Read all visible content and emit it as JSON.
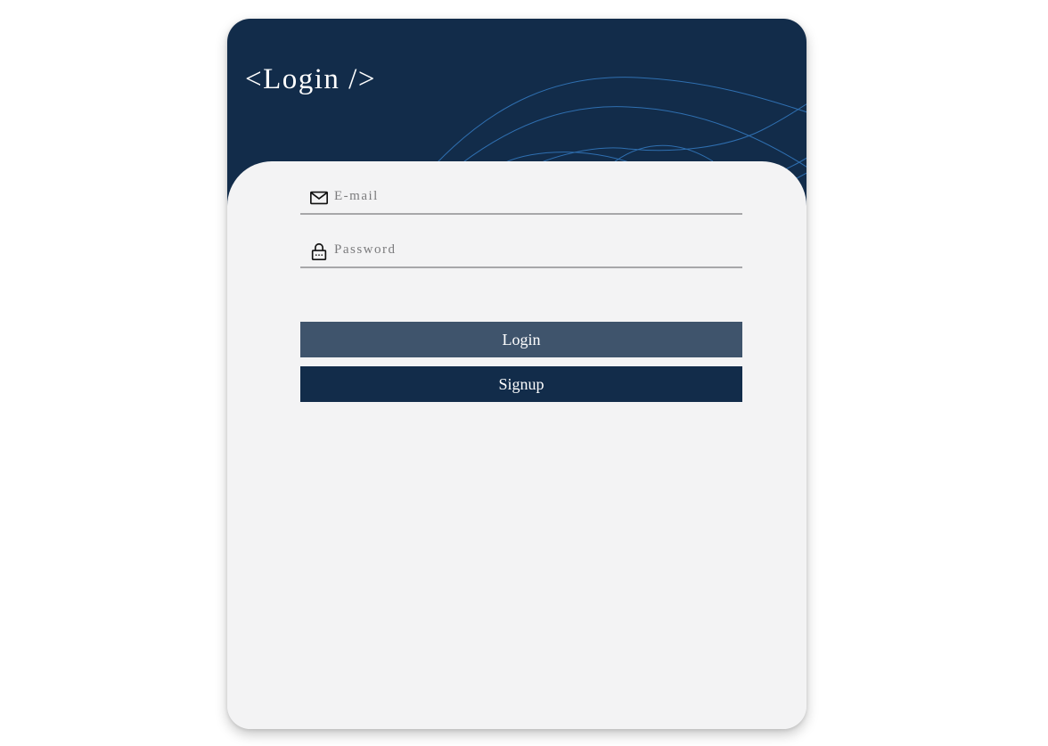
{
  "header": {
    "title": "<Login />"
  },
  "form": {
    "email": {
      "placeholder": "E-mail",
      "value": "",
      "icon": "mail-icon"
    },
    "password": {
      "placeholder": "Password",
      "value": "",
      "icon": "lock-icon"
    }
  },
  "buttons": {
    "login_label": "Login",
    "signup_label": "Signup"
  },
  "colors": {
    "header_bg": "#122c4a",
    "wave_lines": "#2f6fb0",
    "card_bg": "#f3f3f4",
    "login_button": "#3f546c",
    "signup_button": "#122c4a"
  }
}
